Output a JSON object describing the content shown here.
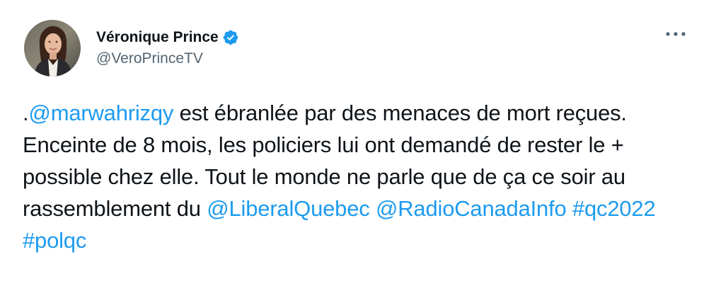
{
  "user": {
    "display_name": "Véronique Prince",
    "handle": "@VeroPrinceTV",
    "verified": true,
    "avatar_icon": "profile-photo"
  },
  "menu": {
    "icon": "more-options-icon"
  },
  "tweet": {
    "prefix": ".",
    "mention_1": "@marwahrizqy",
    "text_1": " est ébranlée par des menaces de mort reçues. Enceinte de 8 mois, les policiers lui ont demandé de rester le + possible chez elle. Tout le monde ne parle que de ça ce soir au rassemblement du ",
    "mention_2": "@LiberalQuebec",
    "space_1": " ",
    "mention_3": "@RadioCanadaInfo",
    "space_2": " ",
    "hashtag_1": "#qc2022",
    "space_3": " ",
    "hashtag_2": "#polqc"
  },
  "colors": {
    "link": "#1d9bf0",
    "text": "#0f1419",
    "secondary": "#536471",
    "verified": "#1d9bf0"
  }
}
